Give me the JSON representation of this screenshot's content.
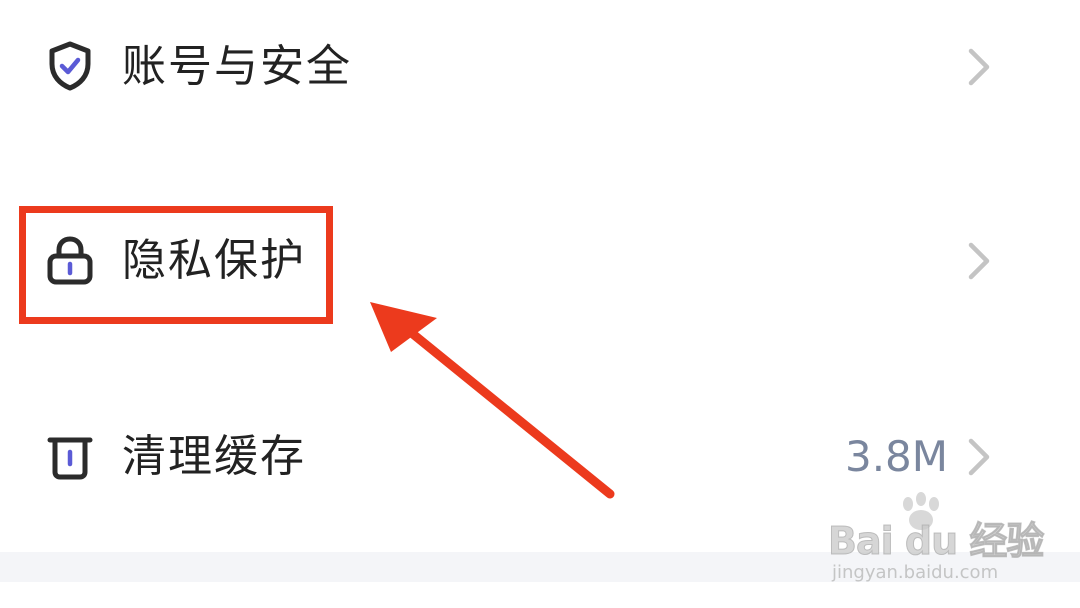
{
  "settings": {
    "items": [
      {
        "label": "账号与安全",
        "icon": "shield-check-icon",
        "value": ""
      },
      {
        "label": "隐私保护",
        "icon": "lock-icon",
        "value": ""
      },
      {
        "label": "清理缓存",
        "icon": "trash-icon",
        "value": "3.8M"
      }
    ]
  },
  "watermark": {
    "logo_text": "Bai du 经验",
    "url": "jingyan.baidu.com"
  },
  "colors": {
    "text": "#222222",
    "value_text": "#7a869e",
    "icon_stroke": "#2b2b2b",
    "icon_accent": "#5b5bd6",
    "chevron": "#c4c4c4",
    "annotation": "#ec3a1d",
    "bottom_strip": "#f4f5f8"
  }
}
